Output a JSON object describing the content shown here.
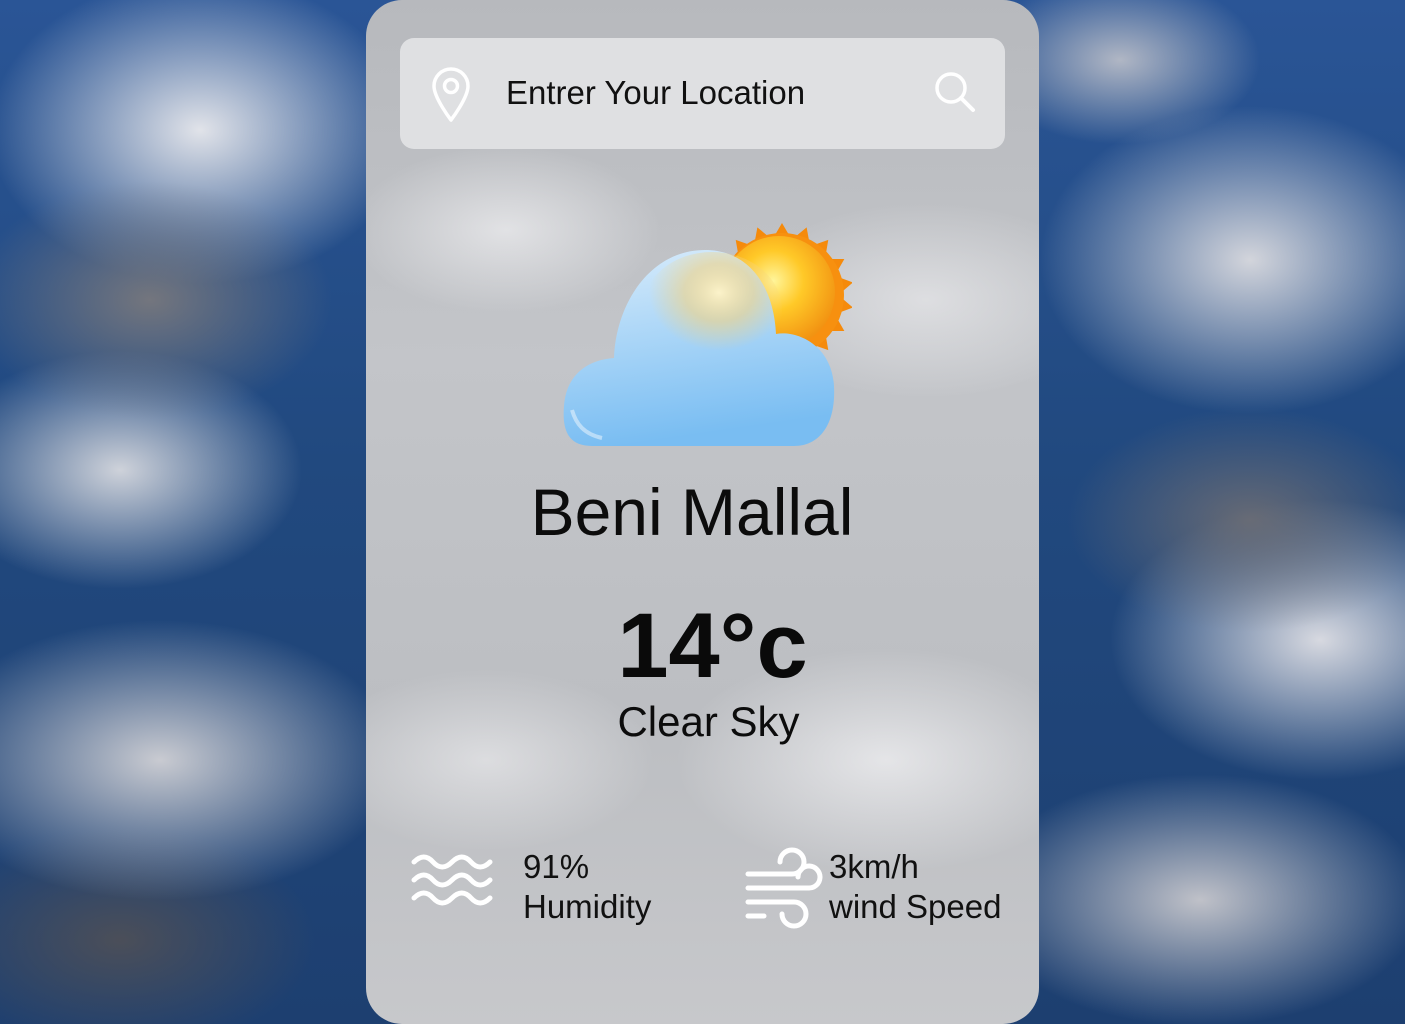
{
  "search": {
    "placeholder": "Entrer Your Location",
    "location_icon": "map-pin-icon",
    "search_icon": "search-icon"
  },
  "weather": {
    "icon": "sun-behind-cloud-icon",
    "city": "Beni Mallal",
    "temperature": "14°c",
    "condition": "Clear Sky"
  },
  "stats": {
    "humidity": {
      "icon": "humidity-waves-icon",
      "value": "91%",
      "label": "Humidity"
    },
    "wind": {
      "icon": "wind-icon",
      "value": "3km/h",
      "label": "wind Speed"
    }
  },
  "colors": {
    "text": "#0c0c0c",
    "sun": "#f7a81b",
    "cloud": "#8ec9f5"
  }
}
